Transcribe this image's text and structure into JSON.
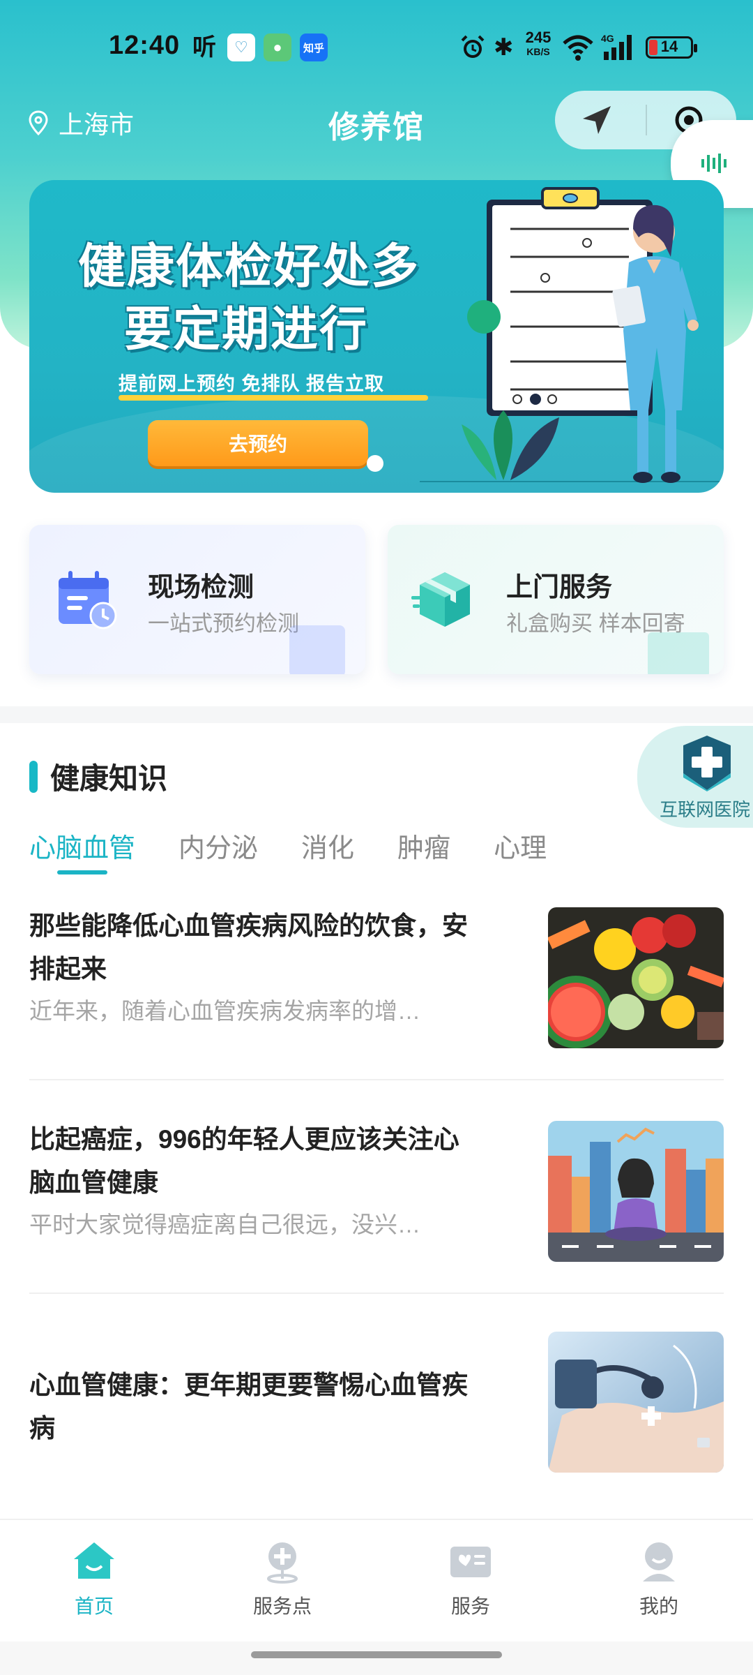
{
  "status_bar": {
    "time": "12:40",
    "app_ting": "听",
    "app_zhihu": "知乎",
    "net_speed": "245",
    "net_unit": "KB/S",
    "network_type": "4G",
    "battery": "14"
  },
  "header": {
    "location": "上海市",
    "title": "修养馆"
  },
  "banner": {
    "headline_1": "健康体检好处多",
    "headline_2": "要定期进行",
    "subline": "提前网上预约  免排队  报告立取",
    "button_label": "去预约"
  },
  "services": [
    {
      "title": "现场检测",
      "subtitle": "一站式预约检测"
    },
    {
      "title": "上门服务",
      "subtitle": "礼盒购买 样本回寄"
    }
  ],
  "knowledge": {
    "section_title": "健康知识",
    "hospital_fab_label": "互联网医院",
    "tabs": [
      {
        "label": "心脑血管",
        "active": true
      },
      {
        "label": "内分泌",
        "active": false
      },
      {
        "label": "消化",
        "active": false
      },
      {
        "label": "肿瘤",
        "active": false
      },
      {
        "label": "心理",
        "active": false
      }
    ],
    "articles": [
      {
        "title": "那些能降低心血管疾病风险的饮食，安排起来",
        "desc": "近年来，随着心血管疾病发病率的增…",
        "image": "vegetables-image"
      },
      {
        "title": "比起癌症，996的年轻人更应该关注心脑血管健康",
        "desc": "平时大家觉得癌症离自己很远，没兴…",
        "image": "meditation-illustration"
      },
      {
        "title": "心血管健康：更年期更要警惕心血管疾病",
        "desc": "",
        "image": "blood-pressure-image"
      }
    ]
  },
  "bottom_nav": [
    {
      "label": "首页",
      "icon": "home-icon",
      "active": true
    },
    {
      "label": "服务点",
      "icon": "location-plus-icon",
      "active": false
    },
    {
      "label": "服务",
      "icon": "service-card-icon",
      "active": false
    },
    {
      "label": "我的",
      "icon": "profile-icon",
      "active": false
    }
  ],
  "colors": {
    "accent": "#1bb4c5",
    "header_gradient_top": "#2ac0cd",
    "header_gradient_bottom": "#bff3dc",
    "banner_bg": "#21b3c5",
    "banner_button": "#ff9a1a"
  }
}
